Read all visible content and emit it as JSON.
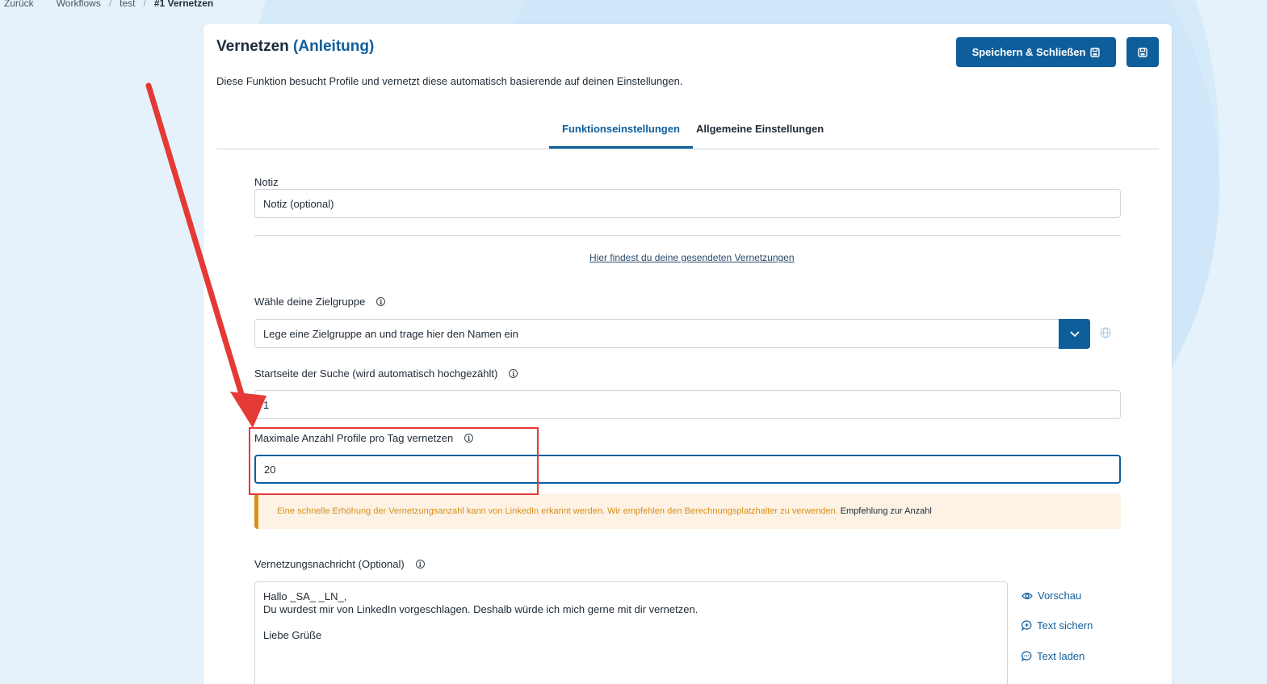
{
  "breadcrumb": {
    "items": [
      "Zurück",
      "Workflows",
      "test"
    ],
    "current": "#1 Vernetzen",
    "separator": "/"
  },
  "header": {
    "title": "Vernetzen",
    "title_link": "(Anleitung)",
    "description": "Diese Funktion besucht Profile und vernetzt diese automatisch basierende auf deinen Einstellungen.",
    "save_close_label": "Speichern & Schließen"
  },
  "tabs": [
    {
      "label": "Funktionseinstellungen",
      "active": true
    },
    {
      "label": "Allgemeine Einstellungen",
      "active": false
    }
  ],
  "form": {
    "note": {
      "label": "Notiz",
      "placeholder": "Notiz (optional)"
    },
    "sent_link": "Hier findest du deine gesendeten Vernetzungen",
    "target_group": {
      "label": "Wähle deine Zielgruppe",
      "value": "Lege eine Zielgruppe an und trage hier den Namen ein"
    },
    "start_page": {
      "label": "Startseite der Suche (wird automatisch hochgezählt)",
      "value": "1"
    },
    "max_profiles": {
      "label": "Maximale Anzahl Profile pro Tag vernetzen",
      "value": "20"
    },
    "warning": {
      "text": "Eine schnelle Erhöhung der Vernetzungsanzahl kann von LinkedIn erkannt werden. Wir empfehlen den Berechnungsplatzhalter zu verwenden.",
      "link": "Empfehlung zur Anzahl"
    },
    "message": {
      "label": "Vernetzungsnachricht (Optional)",
      "value": "Hallo _SA_ _LN_,\nDu wurdest mir von LinkedIn vorgeschlagen. Deshalb würde ich mich gerne mit dir vernetzen.\n\nLiebe Grüße"
    },
    "actions": {
      "preview": "Vorschau",
      "save_text": "Text sichern",
      "load_text": "Text laden"
    }
  },
  "colors": {
    "primary": "#0f5e9c",
    "warning": "#d88f1a",
    "annotation": "#e53935"
  }
}
